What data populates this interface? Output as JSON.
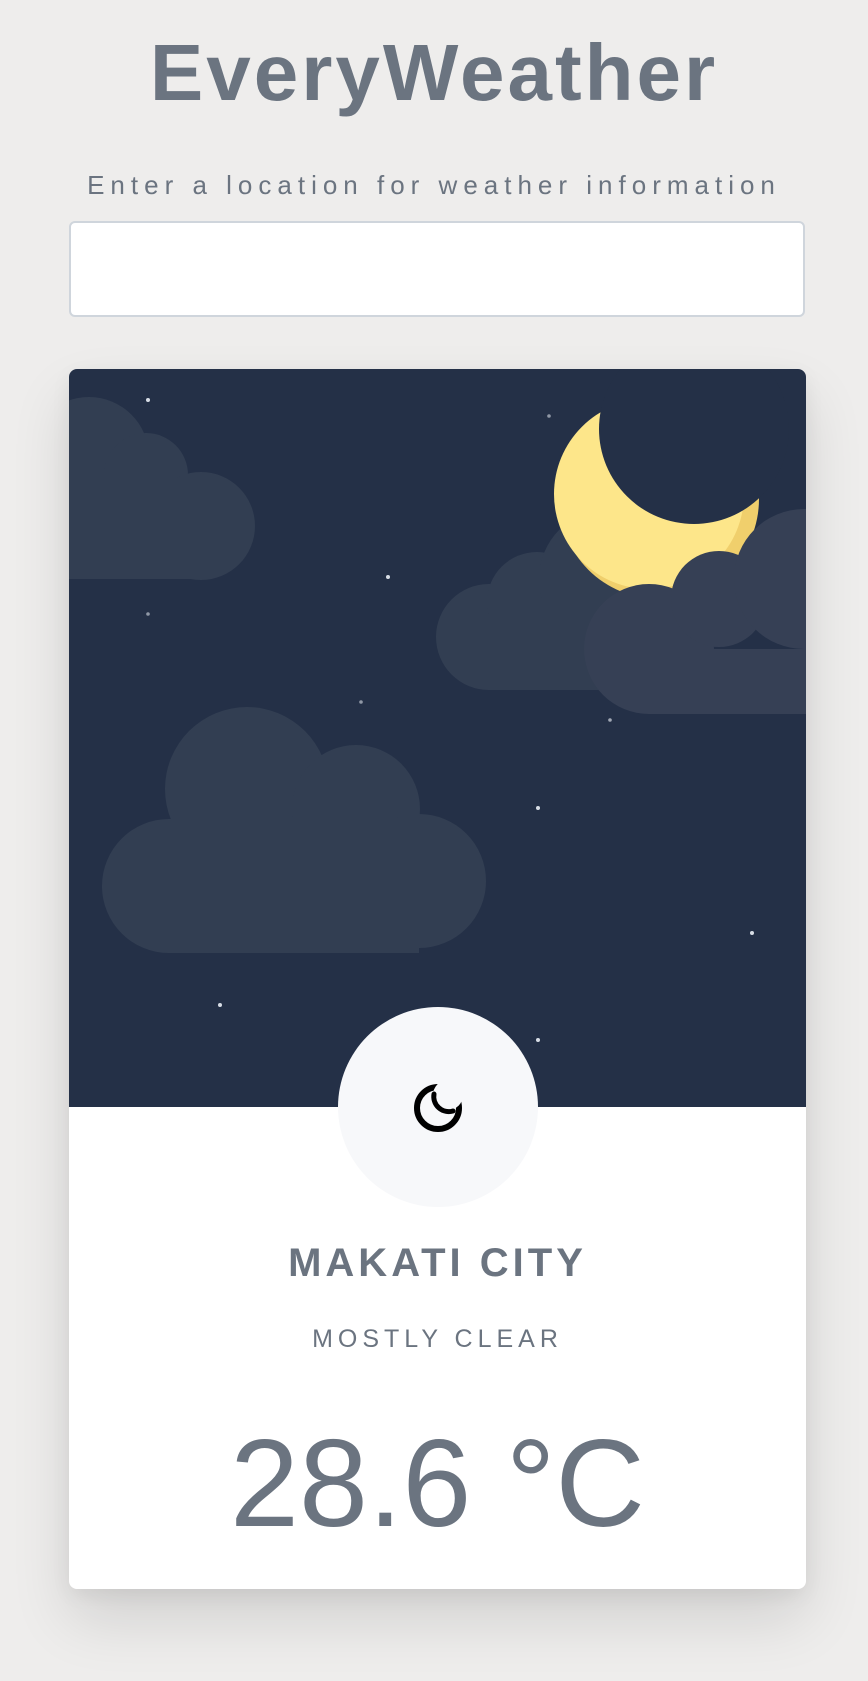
{
  "header": {
    "title": "EveryWeather",
    "prompt": "Enter a location for weather information"
  },
  "search": {
    "value": "",
    "placeholder": ""
  },
  "weather": {
    "city": "MAKATI CITY",
    "condition": "MOSTLY CLEAR",
    "temperature": "28.6 °C",
    "icon": "moon-icon"
  },
  "colors": {
    "night_sky": "#243047",
    "cloud": "#323e52",
    "moon": "#fde68a",
    "moon_shadow": "#f0cf6c",
    "text": "#6b7480",
    "background": "#eeedec"
  }
}
